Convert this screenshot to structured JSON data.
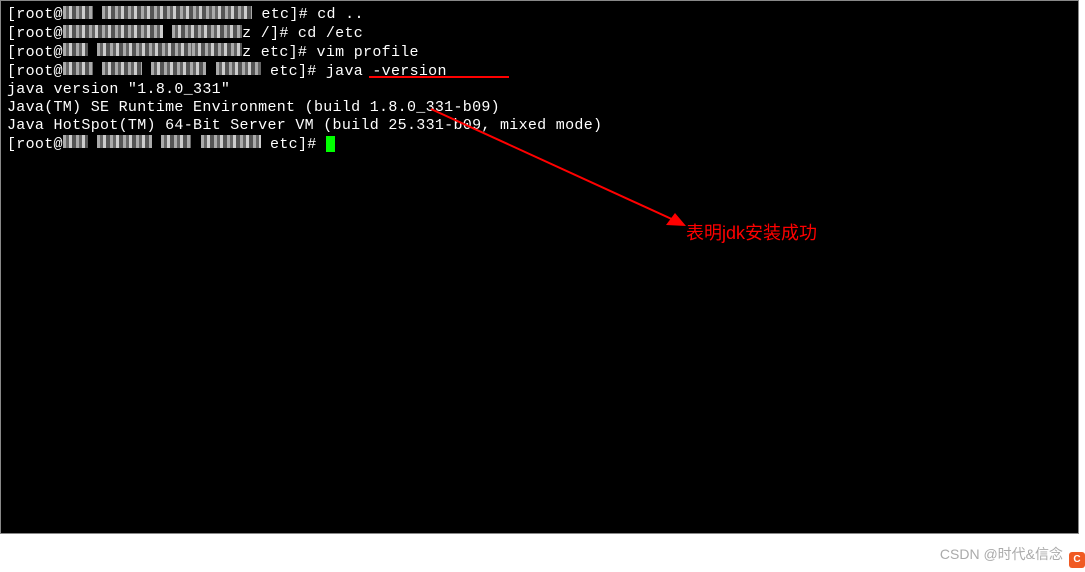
{
  "lines": {
    "l1_prefix": "[root@",
    "l1_suffix": " etc]# cd ..",
    "l2_prefix": "[root@",
    "l2_suffix": "z /]# cd /etc",
    "l3_prefix": "[root@",
    "l3_suffix": "z etc]# vim profile",
    "l4_prefix": "[root@",
    "l4_suffix": " etc]# java -version",
    "l5": "java version \"1.8.0_331\"",
    "l6": "Java(TM) SE Runtime Environment (build 1.8.0_331-b09)",
    "l7": "Java HotSpot(TM) 64-Bit Server VM (build 25.331-b09, mixed mode)",
    "l8_prefix": "[root@",
    "l8_suffix": " etc]# "
  },
  "annotation": "表明jdk安装成功",
  "watermark": "CSDN @时代&信念",
  "logo": "C"
}
